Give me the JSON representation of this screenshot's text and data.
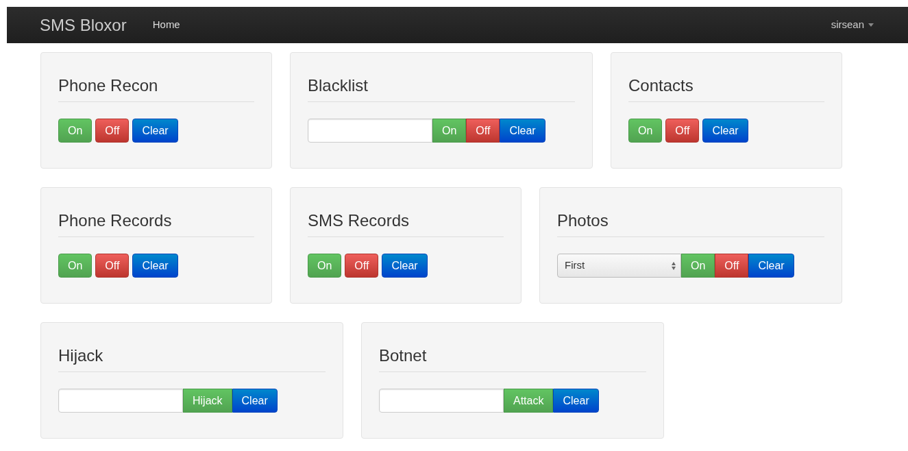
{
  "navbar": {
    "brand": "SMS Bloxor",
    "links": [
      {
        "label": "Home"
      }
    ],
    "user": "sirsean"
  },
  "rows": [
    {
      "panels": [
        {
          "title": "Phone Recon",
          "buttons": [
            {
              "label": "On",
              "kind": "on"
            },
            {
              "label": "Off",
              "kind": "off"
            },
            {
              "label": "Clear",
              "kind": "clear"
            }
          ]
        },
        {
          "title": "Blacklist",
          "field": {
            "kind": "text"
          },
          "buttons": [
            {
              "label": "On",
              "kind": "on"
            },
            {
              "label": "Off",
              "kind": "off"
            },
            {
              "label": "Clear",
              "kind": "clear"
            }
          ]
        },
        {
          "title": "Contacts",
          "buttons": [
            {
              "label": "On",
              "kind": "on"
            },
            {
              "label": "Off",
              "kind": "off"
            },
            {
              "label": "Clear",
              "kind": "clear"
            }
          ]
        }
      ]
    },
    {
      "panels": [
        {
          "title": "Phone Records",
          "buttons": [
            {
              "label": "On",
              "kind": "on"
            },
            {
              "label": "Off",
              "kind": "off"
            },
            {
              "label": "Clear",
              "kind": "clear"
            }
          ]
        },
        {
          "title": "SMS Records",
          "buttons": [
            {
              "label": "On",
              "kind": "on"
            },
            {
              "label": "Off",
              "kind": "off"
            },
            {
              "label": "Clear",
              "kind": "clear"
            }
          ]
        },
        {
          "title": "Photos",
          "field": {
            "kind": "select",
            "value": "First"
          },
          "buttons": [
            {
              "label": "On",
              "kind": "on"
            },
            {
              "label": "Off",
              "kind": "off"
            },
            {
              "label": "Clear",
              "kind": "clear"
            }
          ]
        }
      ]
    },
    {
      "panels": [
        {
          "title": "Hijack",
          "field": {
            "kind": "text"
          },
          "buttons": [
            {
              "label": "Hijack",
              "kind": "on"
            },
            {
              "label": "Clear",
              "kind": "clear"
            }
          ]
        },
        {
          "title": "Botnet",
          "field": {
            "kind": "text"
          },
          "buttons": [
            {
              "label": "Attack",
              "kind": "on"
            },
            {
              "label": "Clear",
              "kind": "clear"
            }
          ]
        }
      ]
    }
  ]
}
